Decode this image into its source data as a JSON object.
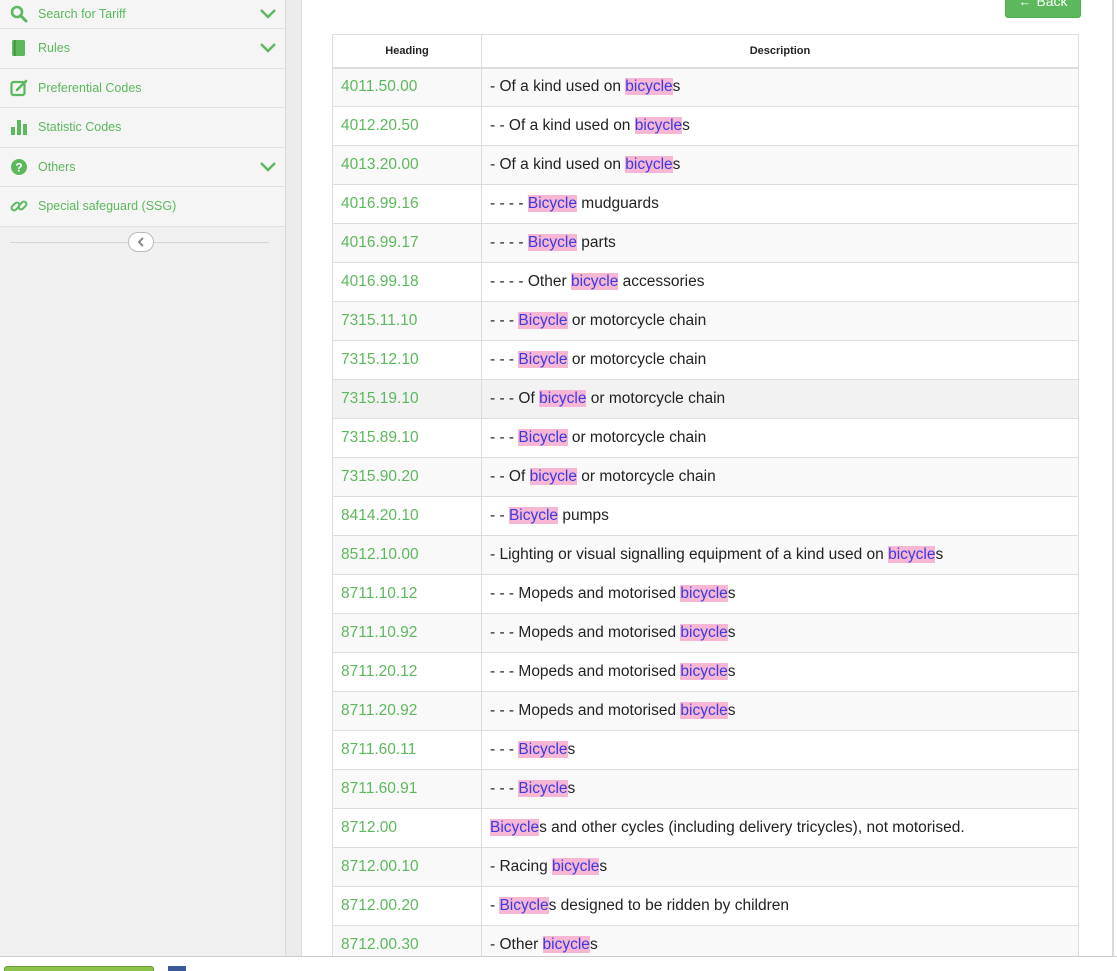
{
  "sidebar": {
    "items": [
      {
        "label": "Search for Tariff",
        "icon": "search-icon",
        "expandable": true
      },
      {
        "label": "Rules",
        "icon": "book-icon",
        "expandable": true
      },
      {
        "label": "Preferential Codes",
        "icon": "edit-icon",
        "expandable": false
      },
      {
        "label": "Statistic Codes",
        "icon": "bar-chart-icon",
        "expandable": false
      },
      {
        "label": "Others",
        "icon": "question-icon",
        "expandable": true
      },
      {
        "label": "Special safeguard (SSG)",
        "icon": "link-icon",
        "expandable": false
      }
    ]
  },
  "main": {
    "back_label": "Back",
    "table": {
      "headers": {
        "heading": "Heading",
        "description": "Description"
      },
      "rows": [
        {
          "code": "4011.50.00",
          "pre": "- Of a kind used on ",
          "hl": "bicycle",
          "post": "s"
        },
        {
          "code": "4012.20.50",
          "pre": "- - Of a kind used on ",
          "hl": "bicycle",
          "post": "s"
        },
        {
          "code": "4013.20.00",
          "pre": "- Of a kind used on ",
          "hl": "bicycle",
          "post": "s"
        },
        {
          "code": "4016.99.16",
          "pre": "- - - - ",
          "hl": "Bicycle",
          "post": " mudguards"
        },
        {
          "code": "4016.99.17",
          "pre": "- - - - ",
          "hl": "Bicycle",
          "post": " parts"
        },
        {
          "code": "4016.99.18",
          "pre": "- - - - Other ",
          "hl": "bicycle",
          "post": " accessories"
        },
        {
          "code": "7315.11.10",
          "pre": "- - - ",
          "hl": "Bicycle",
          "post": " or motorcycle chain"
        },
        {
          "code": "7315.12.10",
          "pre": "- - - ",
          "hl": "Bicycle",
          "post": " or motorcycle chain"
        },
        {
          "code": "7315.19.10",
          "pre": "- - - Of ",
          "hl": "bicycle",
          "post": " or motorcycle chain"
        },
        {
          "code": "7315.89.10",
          "pre": "- - - ",
          "hl": "Bicycle",
          "post": " or motorcycle chain"
        },
        {
          "code": "7315.90.20",
          "pre": "- - Of ",
          "hl": "bicycle",
          "post": " or motorcycle chain"
        },
        {
          "code": "8414.20.10",
          "pre": "- - ",
          "hl": "Bicycle",
          "post": " pumps"
        },
        {
          "code": "8512.10.00",
          "pre": "-  Lighting or visual signalling equipment of a kind used on ",
          "hl": "bicycle",
          "post": "s"
        },
        {
          "code": "8711.10.12",
          "pre": "- - - Mopeds and motorised ",
          "hl": "bicycle",
          "post": "s"
        },
        {
          "code": "8711.10.92",
          "pre": "- - - Mopeds and motorised ",
          "hl": "bicycle",
          "post": "s"
        },
        {
          "code": "8711.20.12",
          "pre": "- - - Mopeds and motorised ",
          "hl": "bicycle",
          "post": "s"
        },
        {
          "code": "8711.20.92",
          "pre": "- - - Mopeds and motorised ",
          "hl": "bicycle",
          "post": "s"
        },
        {
          "code": "8711.60.11",
          "pre": "- - - ",
          "hl": "Bicycle",
          "post": "s"
        },
        {
          "code": "8711.60.91",
          "pre": "- - - ",
          "hl": "Bicycle",
          "post": "s"
        },
        {
          "code": "8712.00",
          "pre": "",
          "hl": "Bicycle",
          "post": "s and other cycles (including delivery tricycles), not motorised."
        },
        {
          "code": "8712.00.10",
          "pre": "- Racing ",
          "hl": "bicycle",
          "post": "s"
        },
        {
          "code": "8712.00.20",
          "pre": "- ",
          "hl": "Bicycle",
          "post": "s designed to be ridden by children"
        },
        {
          "code": "8712.00.30",
          "pre": "- Other ",
          "hl": "bicycle",
          "post": "s"
        }
      ]
    }
  },
  "colors": {
    "accent": "#5cb85c",
    "highlight_bg": "#f7b6d4",
    "highlight_text": "#3a3ae0"
  }
}
